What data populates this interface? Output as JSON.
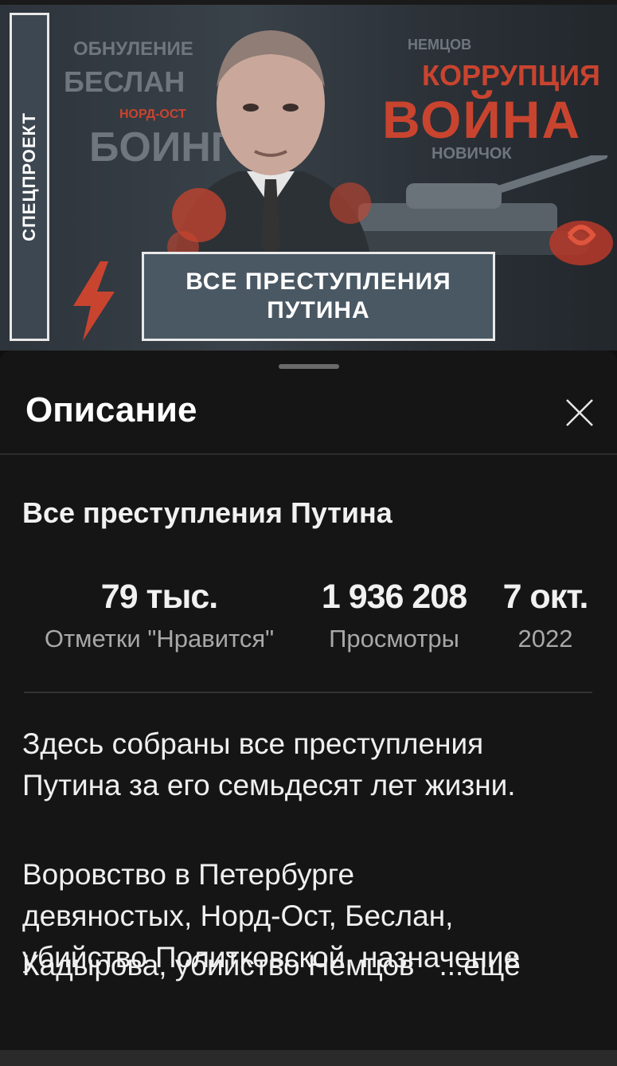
{
  "thumbnail": {
    "side_label": "СПЕЦПРОЕКТ",
    "words": {
      "obnulenie": "ОБНУЛЕНИЕ",
      "beslan": "БЕСЛАН",
      "nord_ost": "НОРД-ОСТ",
      "boing": "БОИНГ",
      "nemtsov": "НЕМЦОВ",
      "korruptsiya": "КОРРУПЦИЯ",
      "voyna": "ВОЙНА",
      "novichok": "НОВИЧОК"
    },
    "plate_line1": "ВСЕ ПРЕСТУПЛЕНИЯ",
    "plate_line2": "ПУТИНА"
  },
  "sheet": {
    "header_title": "Описание",
    "video_title": "Все преступления Путина",
    "stats": {
      "likes_value": "79 тыс.",
      "likes_label": "Отметки \"Нравится\"",
      "views_value": "1 936 208",
      "views_label": "Просмотры",
      "date_value": "7 окт.",
      "date_label": "2022"
    },
    "description": {
      "para1_line1": "Здесь собраны все преступления",
      "para1_line2": "Путина за его семьдесят лет жизни.",
      "para2_line1": "Воровство в Петербурге",
      "para2_line2": "девяностых, Норд-Ост, Беслан,",
      "para2_line3": "убийство Политковской, назначение",
      "para2_line4": "Кадырова, убийство Немцов",
      "more_label": "...ещё"
    }
  },
  "colors": {
    "accent_red": "#c9442f",
    "sheet_bg": "#151515",
    "plate_bg": "#4a5864"
  }
}
